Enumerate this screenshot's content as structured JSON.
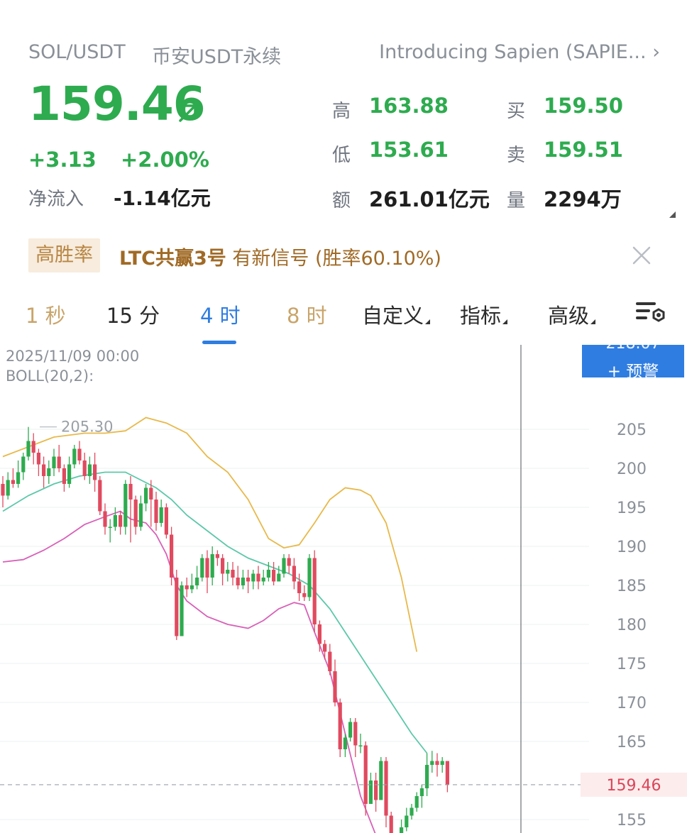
{
  "header": {
    "pair": "SOL/USDT",
    "market": "币安USDT永续",
    "news": "Introducing Sapien (SAPIE...",
    "news_chevron": "›"
  },
  "ticker": {
    "last_price": "159.46",
    "change_abs": "+3.13",
    "change_pct": "+2.00%",
    "net_inflow_label": "净流入",
    "net_inflow_value": "-1.14亿元",
    "high_label": "高",
    "high_value": "163.88",
    "low_label": "低",
    "low_value": "153.61",
    "amount_label": "额",
    "amount_value": "261.01亿元",
    "bid_label": "买",
    "bid_value": "159.50",
    "ask_label": "卖",
    "ask_value": "159.51",
    "volume_label": "量",
    "volume_value": "2294万",
    "up_color": "#2eab4f",
    "down_color": "#e04a5f"
  },
  "signal": {
    "badge": "高胜率",
    "name": "LTC共赢3号",
    "text": "有新信号 (胜率60.10%)"
  },
  "tabs": [
    {
      "label": "1 秒"
    },
    {
      "label": "15 分"
    },
    {
      "label": "4 时"
    },
    {
      "label": "8 时"
    },
    {
      "label": "自定义"
    },
    {
      "label": "指标"
    },
    {
      "label": "高级"
    }
  ],
  "active_tab": "4 时",
  "chart": {
    "date": "2025/11/09 00:00",
    "indicator": "BOLL(20,2):",
    "high_marker": "205.30",
    "top_price": "218.07",
    "alert_label": "+ 预警",
    "current_price": "159.46",
    "y_ticks": [
      "205",
      "200",
      "195",
      "190",
      "185",
      "180",
      "175",
      "170",
      "165",
      "155"
    ]
  },
  "chart_data": {
    "type": "candlestick",
    "indicator": "BOLL(20,2)",
    "ylim": [
      152,
      218.07
    ],
    "current": 159.46,
    "y_ticks": [
      205,
      200,
      195,
      190,
      185,
      180,
      175,
      170,
      165,
      155
    ],
    "candles": [
      [
        198,
        196.5,
        199,
        195
      ],
      [
        196.5,
        198.5,
        199.5,
        196
      ],
      [
        198.5,
        198,
        200,
        197.5
      ],
      [
        198,
        199.5,
        201,
        197.5
      ],
      [
        199.5,
        201.5,
        202,
        198.5
      ],
      [
        201.5,
        203.5,
        205.3,
        201
      ],
      [
        203.5,
        202,
        204.5,
        200.5
      ],
      [
        202,
        200.5,
        202.5,
        199
      ],
      [
        200.5,
        199,
        201.5,
        197.5
      ],
      [
        199,
        200,
        201,
        198
      ],
      [
        200,
        201.5,
        202.5,
        199
      ],
      [
        201.5,
        200,
        203,
        199.5
      ],
      [
        200,
        198,
        200.5,
        197
      ],
      [
        198,
        200.5,
        201.5,
        197.5
      ],
      [
        200.5,
        202.5,
        203,
        200
      ],
      [
        202.5,
        201,
        203.5,
        200.5
      ],
      [
        201,
        199,
        202,
        198.5
      ],
      [
        199,
        200.5,
        201.5,
        198
      ],
      [
        200.5,
        198.5,
        202,
        197
      ],
      [
        198.5,
        194.5,
        199,
        194
      ],
      [
        194.5,
        192.5,
        195.5,
        191.5
      ],
      [
        192.5,
        192.5,
        193.5,
        190.5
      ],
      [
        192.5,
        194,
        195,
        192
      ],
      [
        194,
        192.5,
        194.5,
        191.5
      ],
      [
        192.5,
        198,
        198.5,
        191.5
      ],
      [
        198,
        196,
        199,
        190.5
      ],
      [
        196,
        192.5,
        196.5,
        191.5
      ],
      [
        192.5,
        195.5,
        196.5,
        192
      ],
      [
        195.5,
        197.5,
        198,
        194.5
      ],
      [
        197.5,
        196,
        198.5,
        192.5
      ],
      [
        196,
        193,
        197,
        192
      ],
      [
        193,
        195,
        196,
        192.5
      ],
      [
        195,
        191.5,
        195.5,
        191
      ],
      [
        191.5,
        186,
        192.5,
        185
      ],
      [
        186,
        178.5,
        187,
        178
      ],
      [
        178.5,
        185,
        185.5,
        178.5
      ],
      [
        185,
        184.5,
        186,
        183.5
      ],
      [
        184.5,
        185,
        186.5,
        184
      ],
      [
        185,
        186,
        187.5,
        184.5
      ],
      [
        186,
        188.5,
        189,
        185.5
      ],
      [
        188.5,
        186,
        189.5,
        184
      ],
      [
        186,
        189,
        190,
        185
      ],
      [
        189,
        188.5,
        189.5,
        187.5
      ],
      [
        188.5,
        186.5,
        189,
        185
      ],
      [
        186.5,
        187,
        188,
        185.5
      ],
      [
        187,
        186,
        188,
        185
      ],
      [
        186,
        185,
        187.5,
        184.5
      ],
      [
        185,
        186,
        187,
        184.5
      ],
      [
        186,
        185.5,
        187,
        184
      ],
      [
        185.5,
        186.5,
        187,
        184.5
      ],
      [
        186.5,
        185.5,
        187.5,
        184.5
      ],
      [
        185.5,
        186,
        187,
        185
      ],
      [
        186,
        187,
        188,
        185.5
      ],
      [
        187,
        185.5,
        188,
        185
      ],
      [
        185.5,
        186.5,
        187.5,
        185.5
      ],
      [
        186.5,
        188.5,
        189,
        186
      ],
      [
        188.5,
        187.5,
        189,
        186.5
      ],
      [
        187.5,
        185.5,
        188.5,
        184.5
      ],
      [
        185.5,
        184,
        186.5,
        183
      ],
      [
        184,
        183.5,
        185,
        183
      ],
      [
        183.5,
        188.5,
        189,
        183
      ],
      [
        188.5,
        180,
        189.5,
        179
      ],
      [
        180,
        177.5,
        180.5,
        176.5
      ],
      [
        177.5,
        176.5,
        178,
        175.5
      ],
      [
        176.5,
        174,
        177.5,
        173.5
      ],
      [
        174,
        170,
        175.5,
        169.5
      ],
      [
        170,
        164,
        170.5,
        163
      ],
      [
        164,
        165.5,
        166,
        163
      ],
      [
        165.5,
        167.5,
        168,
        165
      ],
      [
        167.5,
        164.5,
        168,
        163
      ],
      [
        164.5,
        164.5,
        166,
        163.5
      ],
      [
        164.5,
        157,
        165,
        155.5
      ],
      [
        157,
        160,
        161,
        157
      ],
      [
        160,
        157.5,
        161,
        156
      ],
      [
        157.5,
        162.5,
        163,
        157.5
      ],
      [
        162.5,
        155.5,
        163,
        154
      ],
      [
        155.5,
        150,
        156,
        149
      ],
      [
        150,
        151,
        153,
        149.5
      ],
      [
        151,
        154,
        155,
        150.5
      ],
      [
        154,
        155.5,
        156.5,
        153.5
      ],
      [
        155.5,
        156.5,
        157,
        155
      ],
      [
        156.5,
        158,
        158.5,
        156
      ],
      [
        158,
        159,
        159.5,
        156.5
      ],
      [
        159,
        162,
        163.5,
        158
      ],
      [
        162,
        162.5,
        163.8,
        161
      ],
      [
        162.5,
        162,
        163.5,
        160.5
      ],
      [
        162,
        162.5,
        163,
        161
      ],
      [
        162.5,
        159.46,
        162.5,
        158.5
      ]
    ],
    "boll_upper": [
      [
        0,
        201.5
      ],
      [
        6,
        203
      ],
      [
        10,
        204
      ],
      [
        16,
        204.5
      ],
      [
        20,
        204.5
      ],
      [
        24,
        204.8
      ],
      [
        28,
        206.5
      ],
      [
        32,
        205.8
      ],
      [
        36,
        204.5
      ],
      [
        40,
        201.5
      ],
      [
        44,
        199.5
      ],
      [
        48,
        196
      ],
      [
        52,
        191
      ],
      [
        55,
        189.8
      ],
      [
        58,
        190.2
      ],
      [
        61,
        193
      ],
      [
        64,
        196
      ],
      [
        67,
        197.5
      ],
      [
        70,
        197.2
      ],
      [
        72,
        196.5
      ],
      [
        75,
        193
      ],
      [
        78,
        186
      ],
      [
        81,
        176.5
      ]
    ],
    "boll_mid": [
      [
        0,
        194.5
      ],
      [
        5,
        196.5
      ],
      [
        10,
        198
      ],
      [
        15,
        199
      ],
      [
        20,
        199.5
      ],
      [
        24,
        199.5
      ],
      [
        27,
        198.5
      ],
      [
        30,
        197.5
      ],
      [
        33,
        196
      ],
      [
        36,
        194
      ],
      [
        40,
        192
      ],
      [
        44,
        190
      ],
      [
        48,
        188.5
      ],
      [
        52,
        187.5
      ],
      [
        56,
        186.5
      ],
      [
        60,
        185
      ],
      [
        64,
        182
      ],
      [
        68,
        178
      ],
      [
        72,
        174
      ],
      [
        76,
        170
      ],
      [
        80,
        166
      ],
      [
        83,
        163.5
      ]
    ],
    "boll_lower": [
      [
        0,
        188
      ],
      [
        4,
        188.3
      ],
      [
        8,
        189.5
      ],
      [
        12,
        191
      ],
      [
        16,
        192.8
      ],
      [
        20,
        193.8
      ],
      [
        23,
        194.5
      ],
      [
        25,
        193.5
      ],
      [
        28,
        193
      ],
      [
        30,
        191.5
      ],
      [
        32,
        189
      ],
      [
        34,
        185
      ],
      [
        36,
        183
      ],
      [
        40,
        181
      ],
      [
        44,
        180
      ],
      [
        48,
        179.5
      ],
      [
        51,
        180.5
      ],
      [
        54,
        182
      ],
      [
        57,
        182.8
      ],
      [
        59,
        182.5
      ],
      [
        61,
        179
      ],
      [
        64,
        174
      ],
      [
        67,
        166
      ],
      [
        70,
        158
      ],
      [
        73,
        153
      ],
      [
        75,
        151
      ]
    ]
  }
}
